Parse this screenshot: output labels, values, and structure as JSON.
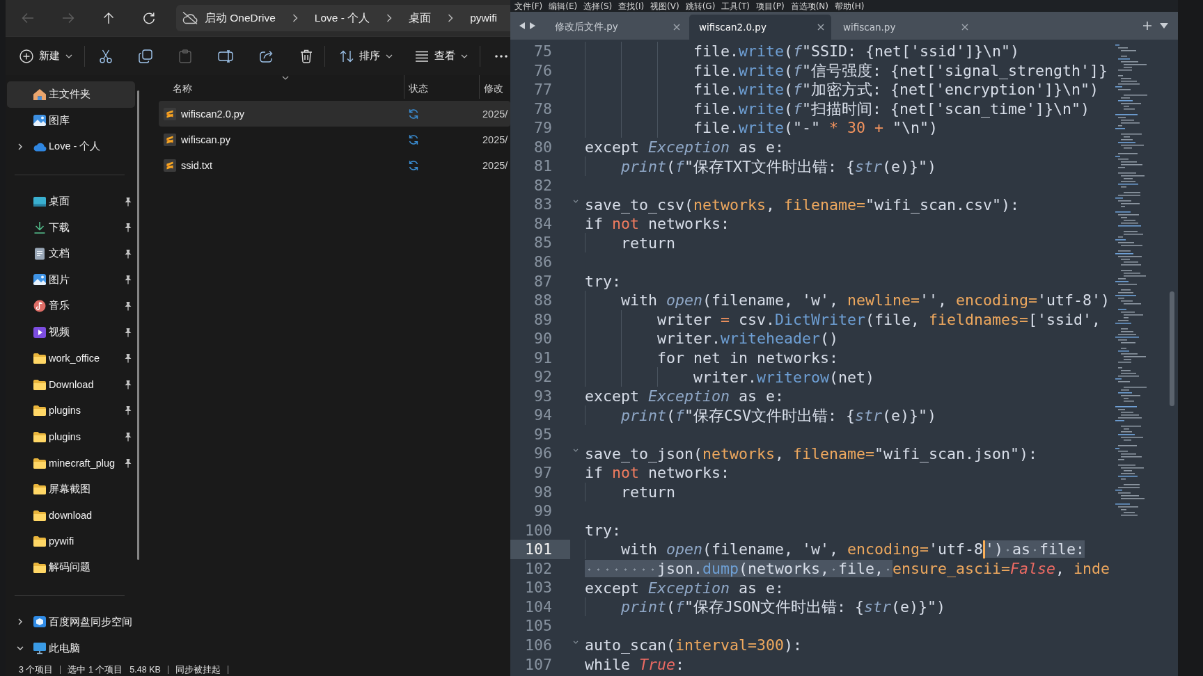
{
  "explorer": {
    "nav_buttons": [
      {
        "kind": "back",
        "disabled": true
      },
      {
        "kind": "forward",
        "disabled": true
      },
      {
        "kind": "up",
        "disabled": false
      },
      {
        "kind": "refresh",
        "disabled": false
      }
    ],
    "address": {
      "breadcrumbs": [
        "启动 OneDrive",
        "Love - 个人",
        "桌面",
        "pywifi"
      ]
    },
    "toolbar": [
      {
        "kind": "new",
        "label": "新建",
        "disabled": false
      },
      {
        "kind": "cut",
        "disabled": false
      },
      {
        "kind": "copy",
        "disabled": false
      },
      {
        "kind": "paste",
        "disabled": true
      },
      {
        "kind": "rename",
        "disabled": false
      },
      {
        "kind": "share",
        "disabled": false
      },
      {
        "kind": "delete",
        "disabled": false
      },
      {
        "kind": "sort",
        "label": "排序",
        "disabled": false
      },
      {
        "kind": "view",
        "label": "查看",
        "disabled": false
      },
      {
        "kind": "more",
        "disabled": false
      }
    ],
    "sidebar": {
      "sections": [
        {
          "items": [
            {
              "label": "主文件夹",
              "kind": "home",
              "selected": true
            },
            {
              "label": "图库",
              "kind": "gallery",
              "selected": false
            },
            {
              "label": "Love - 个人",
              "kind": "cloud",
              "selected": false,
              "expanded": false
            }
          ]
        },
        {
          "items": [
            {
              "label": "桌面",
              "kind": "desktop",
              "selected": false,
              "pinned": true
            },
            {
              "label": "下载",
              "kind": "downloads",
              "selected": false,
              "pinned": true
            },
            {
              "label": "文档",
              "kind": "documents",
              "selected": false,
              "pinned": true
            },
            {
              "label": "图片",
              "kind": "pictures",
              "selected": false,
              "pinned": true
            },
            {
              "label": "音乐",
              "kind": "music",
              "selected": false,
              "pinned": true
            },
            {
              "label": "视频",
              "kind": "videos",
              "selected": false,
              "pinned": true
            },
            {
              "label": "work_office",
              "kind": "folder",
              "selected": false,
              "pinned": true
            },
            {
              "label": "Download",
              "kind": "folder",
              "selected": false,
              "pinned": true
            },
            {
              "label": "plugins",
              "kind": "folder",
              "selected": false,
              "pinned": true
            },
            {
              "label": "plugins",
              "kind": "folder",
              "selected": false,
              "pinned": true
            },
            {
              "label": "minecraft_plug",
              "kind": "folder",
              "selected": false,
              "pinned": true
            },
            {
              "label": "屏幕截图",
              "kind": "folder",
              "selected": false,
              "pinned": false
            },
            {
              "label": "download",
              "kind": "folder",
              "selected": false,
              "pinned": false
            },
            {
              "label": "pywifi",
              "kind": "folder",
              "selected": false,
              "pinned": false
            },
            {
              "label": "解码问题",
              "kind": "folder",
              "selected": false,
              "pinned": false
            }
          ]
        },
        {
          "items": [
            {
              "label": "百度网盘同步空间",
              "kind": "netdisk",
              "selected": false,
              "expanded": false
            },
            {
              "label": "此电脑",
              "kind": "computer",
              "selected": false,
              "expanded": true
            }
          ]
        }
      ]
    },
    "file_list": {
      "columns": [
        "名称",
        "状态",
        "修改"
      ],
      "rows": [
        {
          "name": "wifiscan2.0.py",
          "status": {
            "kind": "sync"
          },
          "modified": "2025/",
          "selected": true
        },
        {
          "name": "wifiscan.py",
          "status": {
            "kind": "sync"
          },
          "modified": "2025/",
          "selected": false
        },
        {
          "name": "ssid.txt",
          "status": {
            "kind": "sync"
          },
          "modified": "2025/",
          "selected": false
        }
      ]
    },
    "status_bar": {
      "groups": [
        [
          "3 个项目"
        ],
        [
          "选中 1 个项目",
          "5.48 KB"
        ],
        [
          "同步被挂起"
        ]
      ]
    }
  },
  "editor": {
    "menu": [
      "文件(F)",
      "编辑(E)",
      "选择(S)",
      "查找(I)",
      "视图(V)",
      "跳转(G)",
      "工具(T)",
      "项目(P)",
      "首选项(N)",
      "帮助(H)"
    ],
    "tabs": [
      {
        "label": "修改后文件.py",
        "selected": false
      },
      {
        "label": "wifiscan2.0.py",
        "selected": true
      },
      {
        "label": "wifiscan.py",
        "selected": false
      }
    ],
    "lines": [
      {
        "number": "75",
        "current": false,
        "fold": false,
        "tokens": [
          {
            "kind": "indent"
          },
          {
            "kind": "indent"
          },
          {
            "kind": "indent"
          },
          {
            "text": "file.",
            "kind": "plain"
          },
          {
            "text": "write",
            "kind": "call"
          },
          {
            "text": "(",
            "kind": "plain"
          },
          {
            "text": "f",
            "kind": "builtin"
          },
          {
            "text": "\"SSID: {net['ssid']}\\n\")",
            "kind": "plain"
          }
        ]
      },
      {
        "number": "76",
        "current": false,
        "fold": false,
        "tokens": [
          {
            "kind": "indent"
          },
          {
            "kind": "indent"
          },
          {
            "kind": "indent"
          },
          {
            "text": "file.",
            "kind": "plain"
          },
          {
            "text": "write",
            "kind": "call"
          },
          {
            "text": "(",
            "kind": "plain"
          },
          {
            "text": "f",
            "kind": "builtin"
          },
          {
            "text": "\"信号强度: {net['signal_strength']}",
            "kind": "plain"
          }
        ]
      },
      {
        "number": "77",
        "current": false,
        "fold": false,
        "tokens": [
          {
            "kind": "indent"
          },
          {
            "kind": "indent"
          },
          {
            "kind": "indent"
          },
          {
            "text": "file.",
            "kind": "plain"
          },
          {
            "text": "write",
            "kind": "call"
          },
          {
            "text": "(",
            "kind": "plain"
          },
          {
            "text": "f",
            "kind": "builtin"
          },
          {
            "text": "\"加密方式: {net['encryption']}\\n\")",
            "kind": "plain"
          }
        ]
      },
      {
        "number": "78",
        "current": false,
        "fold": false,
        "tokens": [
          {
            "kind": "indent"
          },
          {
            "kind": "indent"
          },
          {
            "kind": "indent"
          },
          {
            "text": "file.",
            "kind": "plain"
          },
          {
            "text": "write",
            "kind": "call"
          },
          {
            "text": "(",
            "kind": "plain"
          },
          {
            "text": "f",
            "kind": "builtin"
          },
          {
            "text": "\"扫描时间: {net['scan_time']}\\n\")",
            "kind": "plain"
          }
        ]
      },
      {
        "number": "79",
        "current": false,
        "fold": false,
        "tokens": [
          {
            "kind": "indent"
          },
          {
            "kind": "indent"
          },
          {
            "kind": "indent"
          },
          {
            "text": "file.",
            "kind": "plain"
          },
          {
            "text": "write",
            "kind": "call"
          },
          {
            "text": "(\"-\" ",
            "kind": "plain"
          },
          {
            "text": "* 30 +",
            "kind": "operator"
          },
          {
            "text": " \"\\n\")",
            "kind": "plain"
          }
        ]
      },
      {
        "number": "80",
        "current": false,
        "fold": false,
        "tokens": [
          {
            "text": "except ",
            "kind": "plain"
          },
          {
            "text": "Exception",
            "kind": "builtin"
          },
          {
            "text": " as e:",
            "kind": "plain"
          }
        ]
      },
      {
        "number": "81",
        "current": false,
        "fold": false,
        "tokens": [
          {
            "kind": "indent"
          },
          {
            "text": "print",
            "kind": "builtin"
          },
          {
            "text": "(",
            "kind": "plain"
          },
          {
            "text": "f",
            "kind": "builtin"
          },
          {
            "text": "\"保存TXT文件时出错: {",
            "kind": "plain"
          },
          {
            "text": "str",
            "kind": "builtin"
          },
          {
            "text": "(e)}\")",
            "kind": "plain"
          }
        ]
      },
      {
        "number": "82",
        "current": false,
        "fold": false
      },
      {
        "number": "83",
        "current": false,
        "fold": true,
        "tokens": [
          {
            "text": "save_to_csv(",
            "kind": "plain"
          },
          {
            "text": "networks",
            "kind": "param"
          },
          {
            "text": ", ",
            "kind": "plain"
          },
          {
            "text": "filename=",
            "kind": "param"
          },
          {
            "text": "\"wifi_scan.csv\"):",
            "kind": "plain"
          }
        ]
      },
      {
        "number": "84",
        "current": false,
        "fold": false,
        "tokens": [
          {
            "text": "if ",
            "kind": "plain"
          },
          {
            "text": "not",
            "kind": "keyword_op"
          },
          {
            "text": " networks:",
            "kind": "plain"
          }
        ]
      },
      {
        "number": "85",
        "current": false,
        "fold": false,
        "tokens": [
          {
            "kind": "indent"
          },
          {
            "text": "return",
            "kind": "plain"
          }
        ]
      },
      {
        "number": "86",
        "current": false,
        "fold": false
      },
      {
        "number": "87",
        "current": false,
        "fold": false,
        "tokens": [
          {
            "text": "try:",
            "kind": "plain"
          }
        ]
      },
      {
        "number": "88",
        "current": false,
        "fold": false,
        "tokens": [
          {
            "kind": "indent"
          },
          {
            "text": "with ",
            "kind": "plain"
          },
          {
            "text": "open",
            "kind": "builtin"
          },
          {
            "text": "(filename, 'w', ",
            "kind": "plain"
          },
          {
            "text": "newline=",
            "kind": "param"
          },
          {
            "text": "'', ",
            "kind": "plain"
          },
          {
            "text": "encoding=",
            "kind": "param"
          },
          {
            "text": "'utf-8')",
            "kind": "plain"
          }
        ]
      },
      {
        "number": "89",
        "current": false,
        "fold": false,
        "tokens": [
          {
            "kind": "indent"
          },
          {
            "kind": "indent"
          },
          {
            "text": "writer ",
            "kind": "plain"
          },
          {
            "text": "=",
            "kind": "operator"
          },
          {
            "text": " csv.",
            "kind": "plain"
          },
          {
            "text": "DictWriter",
            "kind": "call"
          },
          {
            "text": "(file, ",
            "kind": "plain"
          },
          {
            "text": "fieldnames=",
            "kind": "param"
          },
          {
            "text": "['ssid',",
            "kind": "plain"
          }
        ]
      },
      {
        "number": "90",
        "current": false,
        "fold": false,
        "tokens": [
          {
            "kind": "indent"
          },
          {
            "kind": "indent"
          },
          {
            "text": "writer.",
            "kind": "plain"
          },
          {
            "text": "writeheader",
            "kind": "call"
          },
          {
            "text": "()",
            "kind": "plain"
          }
        ]
      },
      {
        "number": "91",
        "current": false,
        "fold": false,
        "tokens": [
          {
            "kind": "indent"
          },
          {
            "kind": "indent"
          },
          {
            "text": "for net in networks:",
            "kind": "plain"
          }
        ]
      },
      {
        "number": "92",
        "current": false,
        "fold": false,
        "tokens": [
          {
            "kind": "indent"
          },
          {
            "kind": "indent"
          },
          {
            "kind": "indent"
          },
          {
            "text": "writer.",
            "kind": "plain"
          },
          {
            "text": "writerow",
            "kind": "call"
          },
          {
            "text": "(net)",
            "kind": "plain"
          }
        ]
      },
      {
        "number": "93",
        "current": false,
        "fold": false,
        "tokens": [
          {
            "text": "except ",
            "kind": "plain"
          },
          {
            "text": "Exception",
            "kind": "builtin"
          },
          {
            "text": " as e:",
            "kind": "plain"
          }
        ]
      },
      {
        "number": "94",
        "current": false,
        "fold": false,
        "tokens": [
          {
            "kind": "indent"
          },
          {
            "text": "print",
            "kind": "builtin"
          },
          {
            "text": "(",
            "kind": "plain"
          },
          {
            "text": "f",
            "kind": "builtin"
          },
          {
            "text": "\"保存CSV文件时出错: {",
            "kind": "plain"
          },
          {
            "text": "str",
            "kind": "builtin"
          },
          {
            "text": "(e)}\")",
            "kind": "plain"
          }
        ]
      },
      {
        "number": "95",
        "current": false,
        "fold": false
      },
      {
        "number": "96",
        "current": false,
        "fold": true,
        "tokens": [
          {
            "text": "save_to_json(",
            "kind": "plain"
          },
          {
            "text": "networks",
            "kind": "param"
          },
          {
            "text": ", ",
            "kind": "plain"
          },
          {
            "text": "filename=",
            "kind": "param"
          },
          {
            "text": "\"wifi_scan.json\"):",
            "kind": "plain"
          }
        ]
      },
      {
        "number": "97",
        "current": false,
        "fold": false,
        "tokens": [
          {
            "text": "if ",
            "kind": "plain"
          },
          {
            "text": "not",
            "kind": "keyword_op"
          },
          {
            "text": " networks:",
            "kind": "plain"
          }
        ]
      },
      {
        "number": "98",
        "current": false,
        "fold": false,
        "tokens": [
          {
            "kind": "indent"
          },
          {
            "text": "return",
            "kind": "plain"
          }
        ]
      },
      {
        "number": "99",
        "current": false,
        "fold": false
      },
      {
        "number": "100",
        "current": false,
        "fold": false,
        "tokens": [
          {
            "text": "try:",
            "kind": "plain"
          }
        ]
      },
      {
        "number": "101",
        "current": true,
        "fold": false,
        "tokens": [
          {
            "kind": "indent",
            "selected": false
          },
          {
            "text": "with ",
            "kind": "plain",
            "selected": false
          },
          {
            "text": "open",
            "kind": "builtin",
            "selected": false
          },
          {
            "text": "(filename, 'w', ",
            "kind": "plain",
            "selected": false
          },
          {
            "text": "encoding=",
            "kind": "param",
            "selected": false
          },
          {
            "text": "'utf-8",
            "kind": "plain",
            "selected": false,
            "cursor": true
          },
          {
            "text": "')",
            "kind": "plain",
            "selected": true
          },
          {
            "kind": "space",
            "selected": true
          },
          {
            "text": "as",
            "kind": "plain",
            "selected": true
          },
          {
            "kind": "space",
            "selected": true
          },
          {
            "text": "file:",
            "kind": "plain",
            "selected": true
          }
        ]
      },
      {
        "number": "102",
        "current": false,
        "fold": false,
        "tokens": [
          {
            "kind": "indent",
            "selected": true
          },
          {
            "kind": "indent",
            "selected": true
          },
          {
            "text": "json.",
            "kind": "plain",
            "selected": true
          },
          {
            "text": "dump",
            "kind": "call",
            "selected": true
          },
          {
            "text": "(networks,",
            "kind": "plain",
            "selected": true
          },
          {
            "kind": "space",
            "selected": true
          },
          {
            "text": "file,",
            "kind": "plain",
            "selected": true
          },
          {
            "kind": "space",
            "selected": true
          },
          {
            "text": "ensure_ascii=",
            "kind": "param",
            "selected": false
          },
          {
            "text": "False",
            "kind": "constant",
            "selected": false
          },
          {
            "text": ", ",
            "kind": "plain",
            "selected": false
          },
          {
            "text": "inde",
            "kind": "param",
            "selected": false
          }
        ]
      },
      {
        "number": "103",
        "current": false,
        "fold": false,
        "tokens": [
          {
            "text": "except ",
            "kind": "plain"
          },
          {
            "text": "Exception",
            "kind": "builtin"
          },
          {
            "text": " as e:",
            "kind": "plain"
          }
        ]
      },
      {
        "number": "104",
        "current": false,
        "fold": false,
        "tokens": [
          {
            "kind": "indent"
          },
          {
            "text": "print",
            "kind": "builtin"
          },
          {
            "text": "(",
            "kind": "plain"
          },
          {
            "text": "f",
            "kind": "builtin"
          },
          {
            "text": "\"保存JSON文件时出错: {",
            "kind": "plain"
          },
          {
            "text": "str",
            "kind": "builtin"
          },
          {
            "text": "(e)}\")",
            "kind": "plain"
          }
        ]
      },
      {
        "number": "105",
        "current": false,
        "fold": false
      },
      {
        "number": "106",
        "current": false,
        "fold": true,
        "tokens": [
          {
            "text": "auto_scan(",
            "kind": "plain"
          },
          {
            "text": "interval=300",
            "kind": "param"
          },
          {
            "text": "):",
            "kind": "plain"
          }
        ]
      },
      {
        "number": "107",
        "current": false,
        "fold": false,
        "tokens": [
          {
            "text": "while ",
            "kind": "plain"
          },
          {
            "text": "True",
            "kind": "constant"
          },
          {
            "text": ":",
            "kind": "plain"
          }
        ]
      }
    ]
  }
}
